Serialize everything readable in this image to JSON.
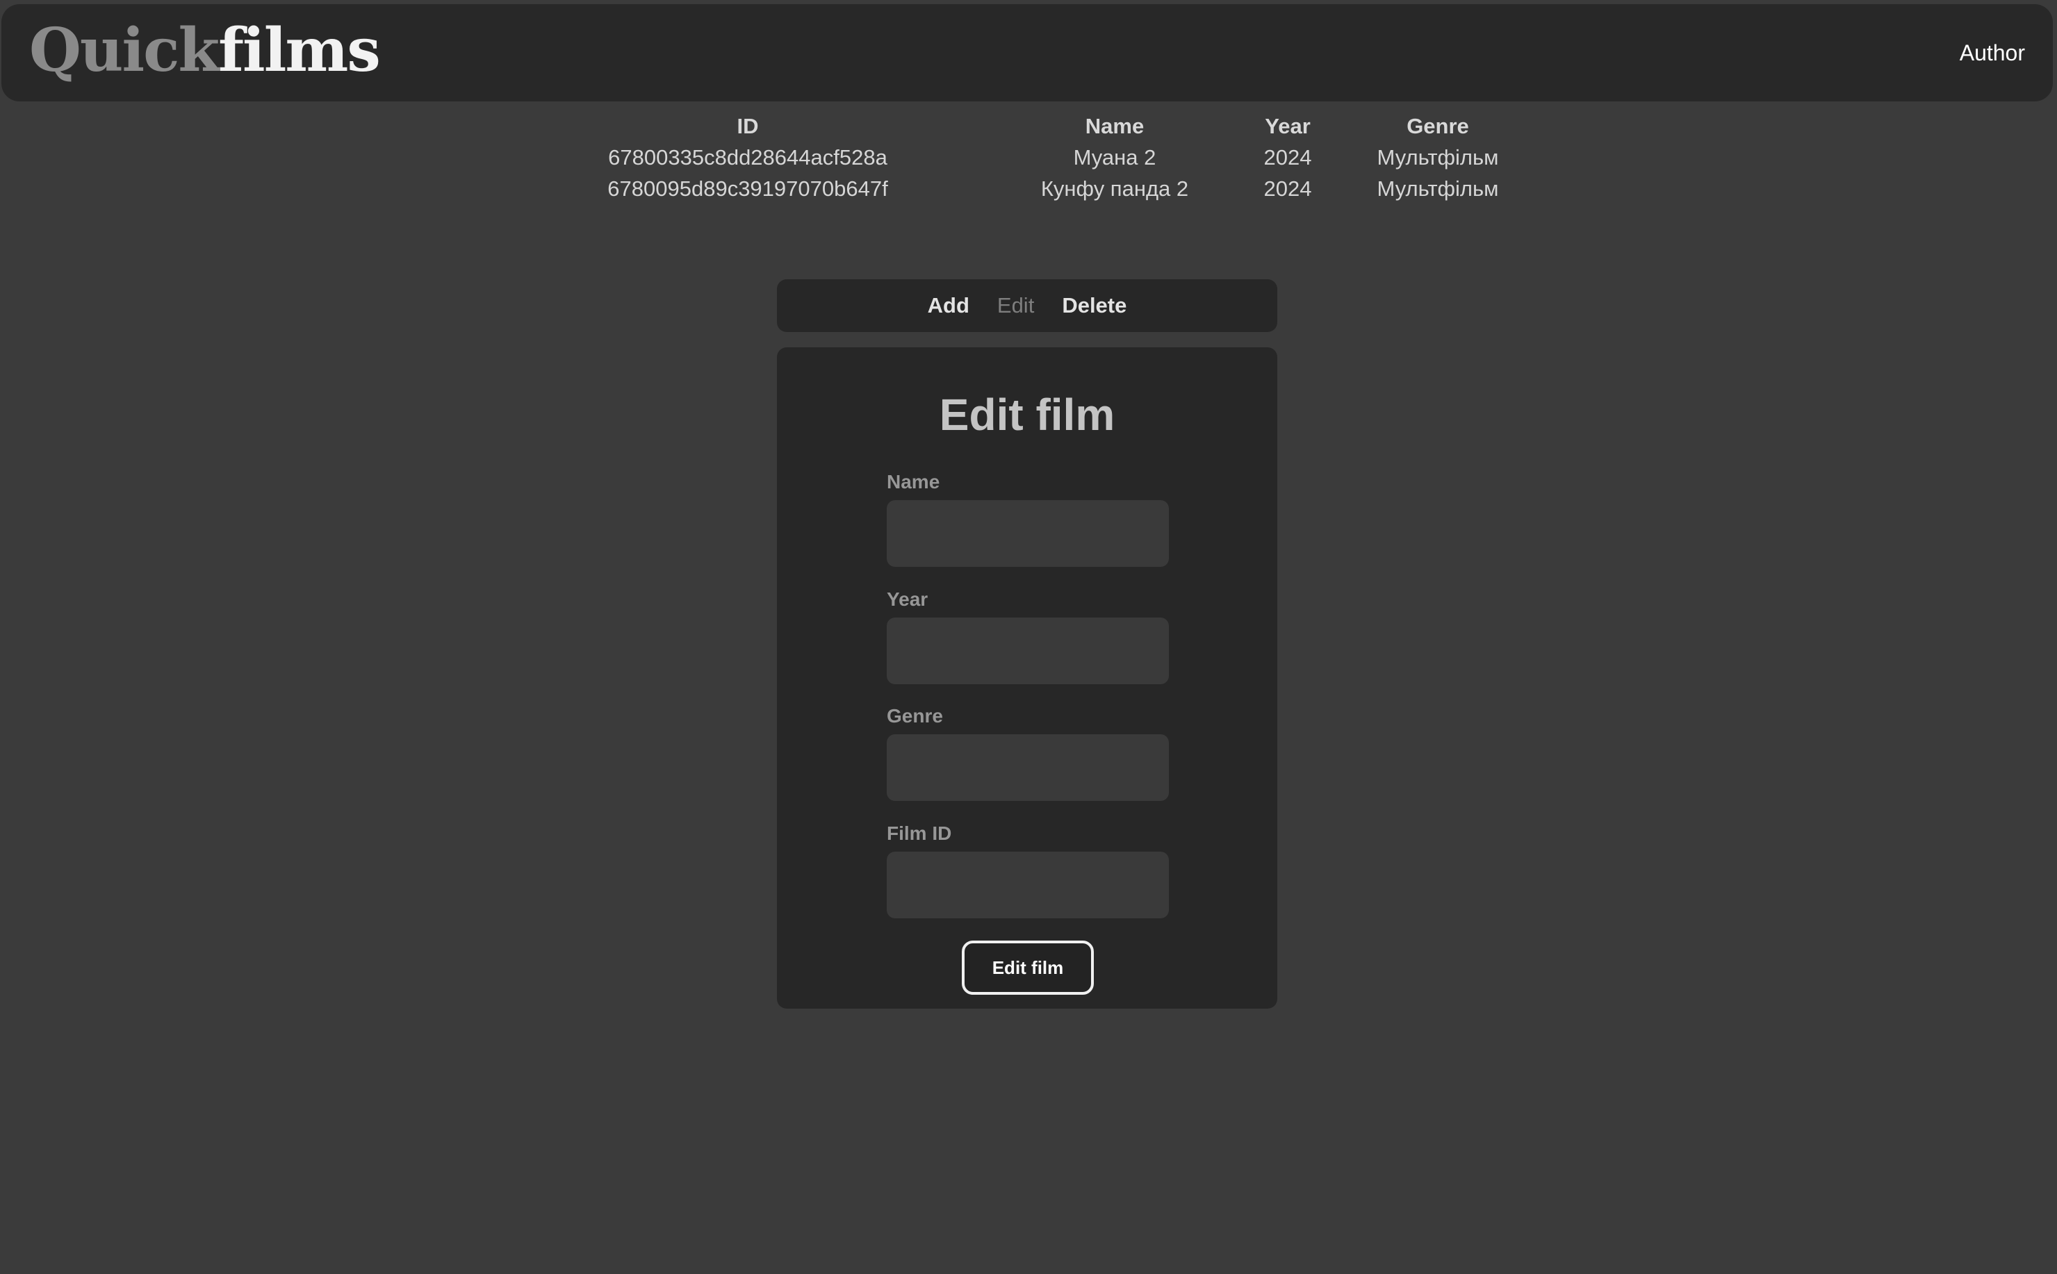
{
  "header": {
    "logo_part1": "Quick",
    "logo_part2": "films",
    "author_link": "Author"
  },
  "films_table": {
    "columns": [
      "ID",
      "Name",
      "Year",
      "Genre"
    ],
    "rows": [
      [
        "67800335c8dd28644acf528a",
        "Муана 2",
        "2024",
        "Мультфільм"
      ],
      [
        "6780095d89c39197070b647f",
        "Кунфу панда 2",
        "2024",
        "Мультфільм"
      ]
    ]
  },
  "tabs": {
    "add": "Add",
    "edit": "Edit",
    "delete": "Delete",
    "active": "edit"
  },
  "form": {
    "title": "Edit film",
    "name_label": "Name",
    "name_value": "",
    "year_label": "Year",
    "year_value": "",
    "genre_label": "Genre",
    "genre_value": "",
    "film_id_label": "Film ID",
    "film_id_value": "",
    "submit_label": "Edit film"
  },
  "colors": {
    "page_background": "#3b3b3b",
    "panel_background": "#272727",
    "input_background": "#3a3a3a",
    "inactive_tab": "#7e7e7e"
  }
}
